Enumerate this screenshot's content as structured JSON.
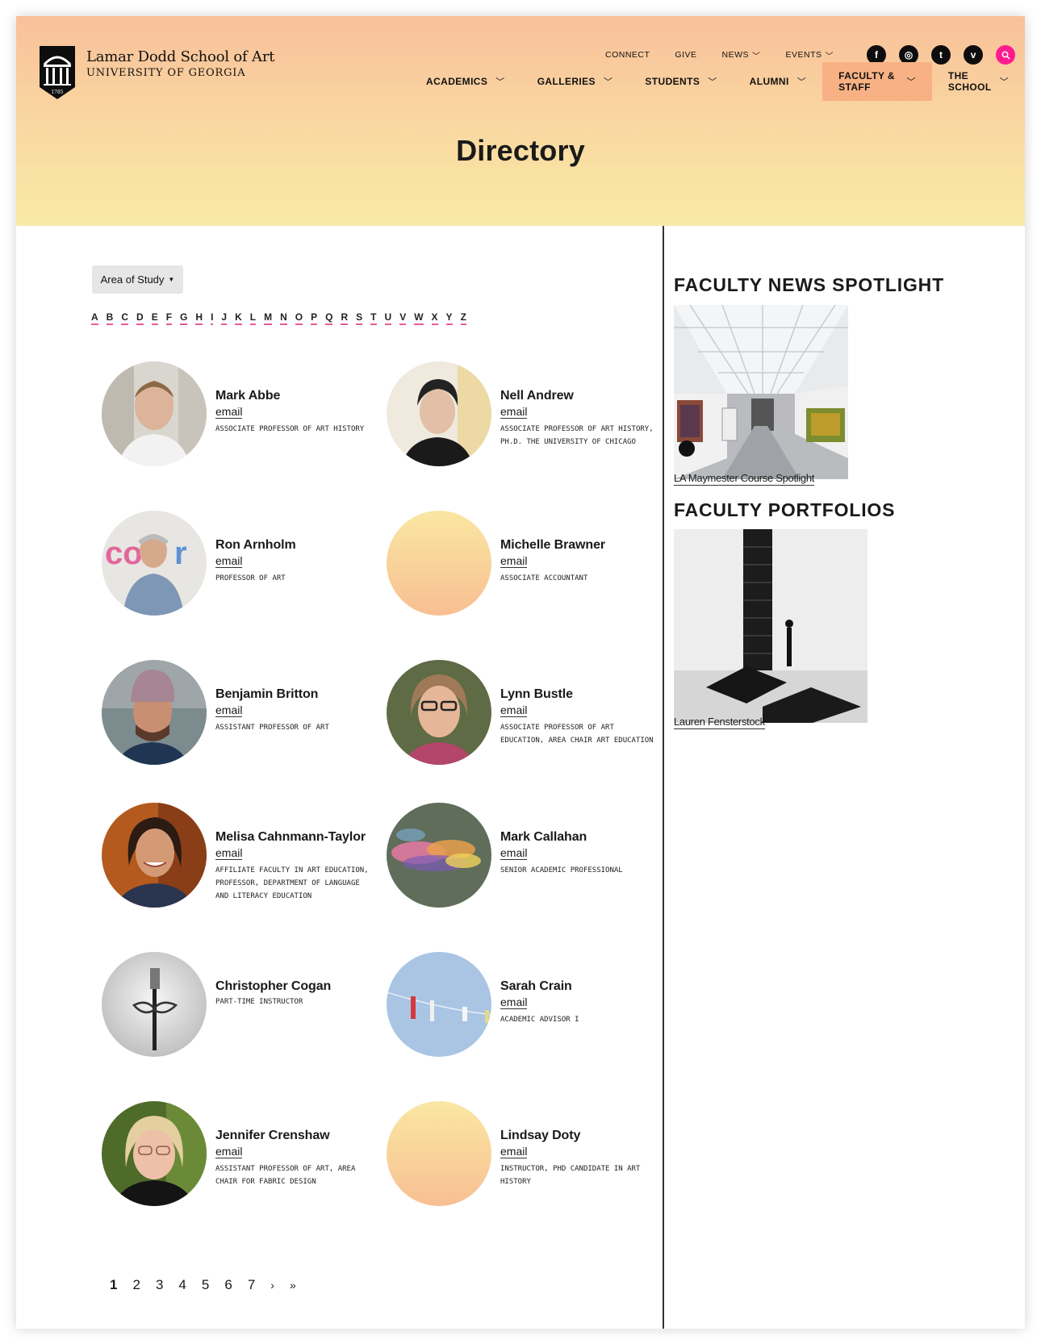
{
  "header": {
    "school_name": "Lamar Dodd School of Art",
    "university": "UNIVERSITY OF GEORGIA",
    "logo_year": "1785",
    "utility_nav": [
      {
        "label": "CONNECT",
        "has_dropdown": false
      },
      {
        "label": "GIVE",
        "has_dropdown": false
      },
      {
        "label": "NEWS",
        "has_dropdown": true
      },
      {
        "label": "EVENTS",
        "has_dropdown": true
      }
    ],
    "social": [
      {
        "name": "facebook-icon",
        "glyph": "f"
      },
      {
        "name": "instagram-icon",
        "glyph": "◎"
      },
      {
        "name": "twitter-icon",
        "glyph": "t"
      },
      {
        "name": "vimeo-icon",
        "glyph": "v"
      }
    ],
    "search_icon": "search-icon",
    "main_nav": [
      {
        "label": "ACADEMICS",
        "active": false
      },
      {
        "label": "GALLERIES",
        "active": false
      },
      {
        "label": "STUDENTS",
        "active": false
      },
      {
        "label": "ALUMNI",
        "active": false
      },
      {
        "label": "FACULTY & STAFF",
        "active": true
      },
      {
        "label": "THE SCHOOL",
        "active": false
      }
    ]
  },
  "page": {
    "title": "Directory"
  },
  "filters": {
    "area_of_study_label": "Area of Study",
    "alphabet": [
      "A",
      "B",
      "C",
      "D",
      "E",
      "F",
      "G",
      "H",
      "I",
      "J",
      "K",
      "L",
      "M",
      "N",
      "O",
      "P",
      "Q",
      "R",
      "S",
      "T",
      "U",
      "V",
      "W",
      "X",
      "Y",
      "Z"
    ]
  },
  "people": [
    {
      "name": "Mark Abbe",
      "email_label": "email",
      "title": "ASSOCIATE PROFESSOR OF ART HISTORY",
      "avatar": "photo"
    },
    {
      "name": "Nell Andrew",
      "email_label": "email",
      "title": "ASSOCIATE PROFESSOR OF ART HISTORY, PH.D. THE UNIVERSITY OF CHICAGO",
      "avatar": "photo"
    },
    {
      "name": "Ron Arnholm",
      "email_label": "email",
      "title": "PROFESSOR OF ART",
      "avatar": "photo"
    },
    {
      "name": "Michelle Brawner",
      "email_label": "email",
      "title": "ASSOCIATE ACCOUNTANT",
      "avatar": "placeholder-gradient"
    },
    {
      "name": "Benjamin Britton",
      "email_label": "email",
      "title": "ASSISTANT PROFESSOR OF ART",
      "avatar": "photo"
    },
    {
      "name": "Lynn Bustle",
      "email_label": "email",
      "title": "ASSOCIATE PROFESSOR OF ART EDUCATION, AREA CHAIR ART EDUCATION",
      "avatar": "photo"
    },
    {
      "name": "Melisa Cahnmann-Taylor",
      "email_label": "email",
      "title": "AFFILIATE FACULTY IN ART EDUCATION, PROFESSOR, DEPARTMENT OF LANGUAGE AND LITERACY EDUCATION",
      "avatar": "photo"
    },
    {
      "name": "Mark Callahan",
      "email_label": "email",
      "title": "SENIOR ACADEMIC PROFESSIONAL",
      "avatar": "photo"
    },
    {
      "name": "Christopher Cogan",
      "email_label": "",
      "title": "PART-TIME INSTRUCTOR",
      "avatar": "photo"
    },
    {
      "name": "Sarah Crain",
      "email_label": "email",
      "title": "ACADEMIC ADVISOR I",
      "avatar": "photo"
    },
    {
      "name": "Jennifer Crenshaw",
      "email_label": "email",
      "title": "ASSISTANT PROFESSOR OF ART, AREA CHAIR FOR FABRIC DESIGN",
      "avatar": "photo"
    },
    {
      "name": "Lindsay Doty",
      "email_label": "email",
      "title": "INSTRUCTOR, PHD CANDIDATE IN ART HISTORY",
      "avatar": "placeholder-gradient"
    }
  ],
  "pagination": {
    "pages": [
      "1",
      "2",
      "3",
      "4",
      "5",
      "6",
      "7"
    ],
    "current": "1",
    "next": "›",
    "last": "»"
  },
  "sidebar": {
    "news_heading": "FACULTY NEWS SPOTLIGHT",
    "news_link": "LA Maymester Course Spotlight",
    "portfolios_heading": "FACULTY PORTFOLIOS",
    "portfolio_link": "Lauren Fensterstock"
  },
  "colors": {
    "header_gradient_top": "#f9c09a",
    "header_gradient_bottom": "#f9eaa6",
    "active_nav": "#f8b184",
    "search_button": "#ff1b8d",
    "alpha_underline": "#e75a9a"
  }
}
